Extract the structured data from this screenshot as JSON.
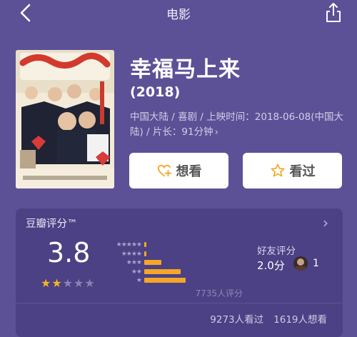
{
  "header": {
    "title": "电影",
    "back_icon": "chevron-left-icon",
    "share_icon": "share-icon"
  },
  "movie": {
    "title": "幸福马上来",
    "year": "(2018)",
    "meta": "中国大陆 / 喜剧 / 上映时间：2018-06-08(中国大陆) / 片长：91分钟",
    "meta_chevron": "›"
  },
  "actions": {
    "want_label": "想看",
    "seen_label": "看过",
    "want_icon": "heart-plus-icon",
    "seen_icon": "star-outline-icon",
    "icon_color": "#f5a623"
  },
  "rating": {
    "title": "豆瓣评分™",
    "score": "3.8",
    "stars_filled": 2,
    "stars_total": 5,
    "distribution": [
      {
        "stars": "★★★★★",
        "fraction": 0.02
      },
      {
        "stars": "★★★★",
        "fraction": 0.02
      },
      {
        "stars": "★★★",
        "fraction": 0.14
      },
      {
        "stars": "★★",
        "fraction": 0.3
      },
      {
        "stars": "★",
        "fraction": 0.34
      }
    ],
    "count": "7735人评分",
    "friend_label": "好友评分",
    "friend_score": "2.0分",
    "friend_count": "1",
    "seen_stat": "9273人看过",
    "want_stat": "1619人想看",
    "accent": "#f5a629"
  }
}
